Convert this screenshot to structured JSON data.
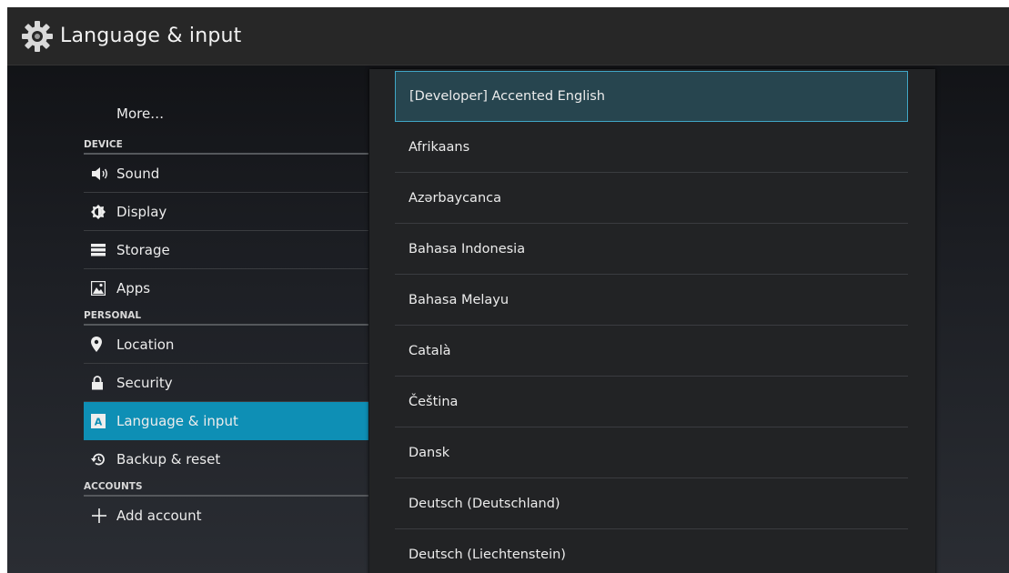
{
  "action_bar": {
    "title": "Language & input",
    "icon": "settings-gear-icon"
  },
  "sidebar": {
    "more_label": "More…",
    "sections": [
      {
        "header": "DEVICE",
        "items": [
          {
            "label": "Sound",
            "icon": "speaker-icon"
          },
          {
            "label": "Display",
            "icon": "brightness-icon"
          },
          {
            "label": "Storage",
            "icon": "storage-icon"
          },
          {
            "label": "Apps",
            "icon": "apps-icon"
          }
        ]
      },
      {
        "header": "PERSONAL",
        "items": [
          {
            "label": "Location",
            "icon": "location-pin-icon"
          },
          {
            "label": "Security",
            "icon": "lock-icon"
          },
          {
            "label": "Language & input",
            "icon": "keyboard-a-icon",
            "selected": true
          },
          {
            "label": "Backup & reset",
            "icon": "restore-icon"
          }
        ]
      },
      {
        "header": "ACCOUNTS",
        "items": [
          {
            "label": "Add account",
            "icon": "plus-icon"
          }
        ]
      }
    ]
  },
  "language_dialog": {
    "items": [
      "[Developer] Accented English",
      "Afrikaans",
      "Azərbaycanca",
      "Bahasa Indonesia",
      "Bahasa Melayu",
      "Català",
      "Čeština",
      "Dansk",
      "Deutsch (Deutschland)",
      "Deutsch (Liechtenstein)"
    ],
    "focused_index": 0
  },
  "colors": {
    "accent": "#0e8fb5",
    "focus_border": "#40a6c6",
    "focus_fill": "#27454f",
    "dialog_bg": "#222325"
  }
}
